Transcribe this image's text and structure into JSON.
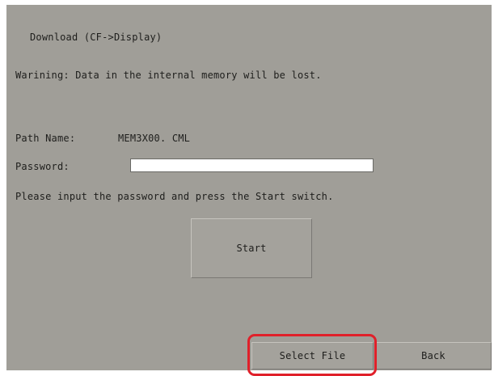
{
  "screen": {
    "title": "Download (CF->Display)",
    "warning": "Warining: Data in the internal memory will be lost.",
    "path_label": "Path Name:",
    "path_value": "MEM3X00. CML",
    "password_label": "Password:",
    "password_value": "",
    "instruction": "Please input the password and press the Start switch.",
    "start_label": "Start"
  },
  "footer": {
    "select_file_label": "Select File",
    "back_label": "Back"
  },
  "colors": {
    "panel_background": "#a09e98",
    "highlight": "#e0202a"
  }
}
